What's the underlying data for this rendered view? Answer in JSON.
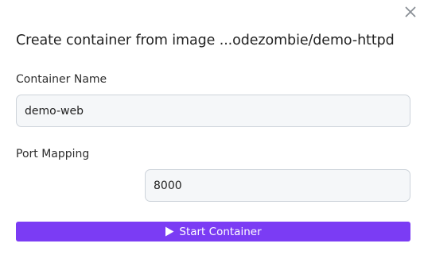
{
  "dialog": {
    "title": "Create container from image ...odezombie/demo-httpd",
    "close_icon": "close-icon"
  },
  "form": {
    "container_name": {
      "label": "Container Name",
      "value": "demo-web"
    },
    "port_mapping": {
      "label": "Port Mapping",
      "value": "8000"
    }
  },
  "actions": {
    "start_label": "Start Container",
    "start_icon": "play-icon"
  },
  "colors": {
    "accent": "#7b3cf4"
  }
}
